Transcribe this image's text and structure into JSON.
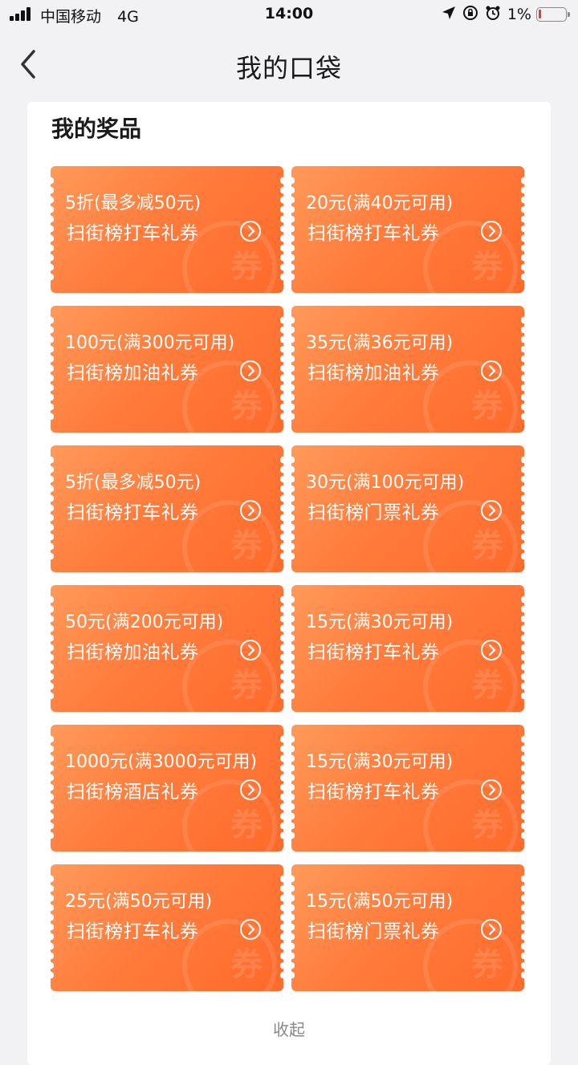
{
  "status_bar": {
    "carrier": "中国移动",
    "network": "4G",
    "time": "14:00",
    "battery_percent": "1%",
    "icons": [
      "location-arrow-icon",
      "orientation-lock-icon",
      "alarm-clock-icon"
    ]
  },
  "nav": {
    "title": "我的口袋",
    "back_icon": "chevron-left-icon"
  },
  "section": {
    "title": "我的奖品"
  },
  "coupons": [
    {
      "value": "5折(最多减50元)",
      "name": "扫街榜打车礼券"
    },
    {
      "value": "20元(满40元可用)",
      "name": "扫街榜打车礼券"
    },
    {
      "value": "100元(满300元可用)",
      "name": "扫街榜加油礼券"
    },
    {
      "value": "35元(满36元可用)",
      "name": "扫街榜加油礼券"
    },
    {
      "value": "5折(最多减50元)",
      "name": "扫街榜打车礼券"
    },
    {
      "value": "30元(满100元可用)",
      "name": "扫街榜门票礼券"
    },
    {
      "value": "50元(满200元可用)",
      "name": "扫街榜加油礼券"
    },
    {
      "value": "15元(满30元可用)",
      "name": "扫街榜打车礼券"
    },
    {
      "value": "1000元(满3000元可用)",
      "name": "扫街榜酒店礼券"
    },
    {
      "value": "15元(满30元可用)",
      "name": "扫街榜打车礼券"
    },
    {
      "value": "25元(满50元可用)",
      "name": "扫街榜打车礼券"
    },
    {
      "value": "15元(满50元可用)",
      "name": "扫街榜门票礼券"
    }
  ],
  "coupon_watermark": "券",
  "coupon_arrow_icon": "chevron-right-circle-icon",
  "collapse_label": "收起",
  "colors": {
    "coupon_start": "#ff9a5a",
    "coupon_end": "#ff6a2a",
    "background": "#f2f2f4"
  }
}
